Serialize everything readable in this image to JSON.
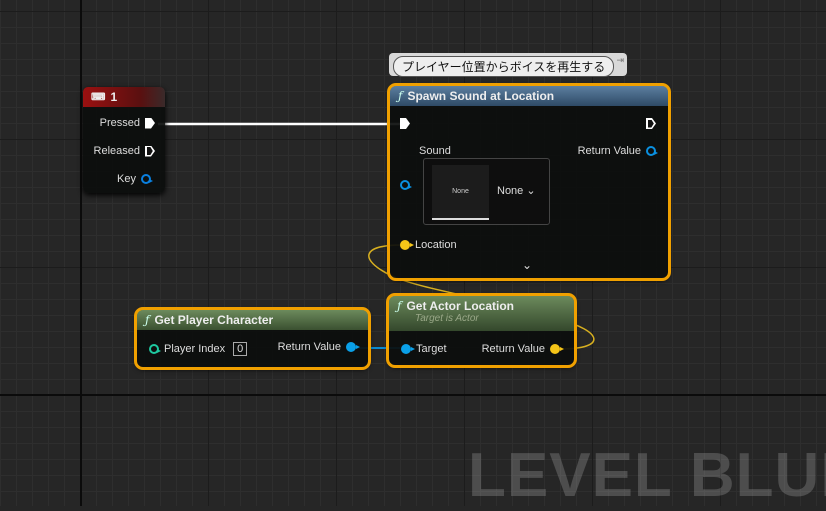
{
  "watermark": "LEVEL BLUEPRINT",
  "comment": {
    "text": "プレイヤー位置からボイスを再生する"
  },
  "key_event": {
    "title": "1",
    "icon": "keyboard-icon",
    "pins": {
      "pressed": "Pressed",
      "released": "Released",
      "key": "Key"
    }
  },
  "spawn_sound": {
    "title": "Spawn Sound at Location",
    "sound_label": "Sound",
    "return_label": "Return Value",
    "asset_thumb": "None",
    "asset_value": "None",
    "location_label": "Location"
  },
  "get_player": {
    "title": "Get Player Character",
    "player_index_label": "Player Index",
    "player_index_value": "0",
    "return_label": "Return Value"
  },
  "get_actor_location": {
    "title": "Get Actor Location",
    "subtitle": "Target is Actor",
    "target_label": "Target",
    "return_label": "Return Value"
  },
  "colors": {
    "selection": "#f0a000",
    "object_pin": "#0aa0e8",
    "vector_pin": "#f5c518",
    "int_pin": "#1ec8a0",
    "event_header": "#8a1414",
    "function_header": "#3c5a78",
    "pure_header": "#4d6b44"
  }
}
